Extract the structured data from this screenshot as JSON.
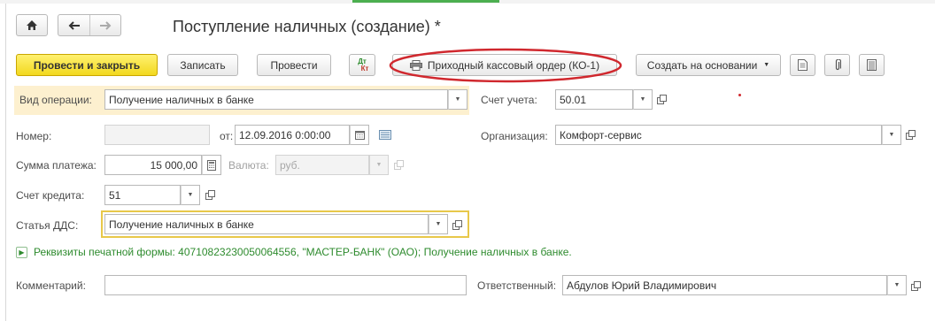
{
  "window": {
    "title": "Поступление наличных (создание) *"
  },
  "toolbar": {
    "post_close": "Провести и закрыть",
    "save": "Записать",
    "post": "Провести",
    "dtkt_top": "Дт",
    "dtkt_bottom": "Кт",
    "print_order": "Приходный кассовый ордер (КО-1)",
    "create_based_on": "Создать на основании"
  },
  "form": {
    "operation_type": {
      "label": "Вид операции:",
      "value": "Получение наличных в банке"
    },
    "account": {
      "label": "Счет учета:",
      "value": "50.01"
    },
    "number": {
      "label": "Номер:",
      "value": ""
    },
    "date": {
      "label": "от:",
      "value": "12.09.2016  0:00:00"
    },
    "organization": {
      "label": "Организация:",
      "value": "Комфорт-сервис"
    },
    "amount": {
      "label": "Сумма платежа:",
      "value": "15 000,00"
    },
    "currency": {
      "label": "Валюта:",
      "value": "руб."
    },
    "credit_account": {
      "label": "Счет кредита:",
      "value": "51"
    },
    "dds_item": {
      "label": "Статья ДДС:",
      "value": "Получение наличных в банке"
    },
    "print_requisites": "Реквизиты печатной формы: 40710823230050064556, \"МАСТЕР-БАНК\" (ОАО); Получение наличных в банке.",
    "comment": {
      "label": "Комментарий:",
      "value": ""
    },
    "responsible": {
      "label": "Ответственный:",
      "value": "Абдулов Юрий Владимирович"
    }
  },
  "icons": [
    "home-icon",
    "back-arrow-icon",
    "forward-arrow-icon",
    "dtkt-icon",
    "printer-icon",
    "report-icon",
    "paperclip-icon",
    "list-icon",
    "calendar-icon",
    "calculator-icon",
    "open-form-icon",
    "dropdown-icon",
    "expand-icon"
  ],
  "colors": {
    "primary": "#f2d81e",
    "highlight": "#fdf0cf",
    "annotation": "#d0282e",
    "link_green": "#2e8b2e",
    "focus": "#e8c84a"
  }
}
